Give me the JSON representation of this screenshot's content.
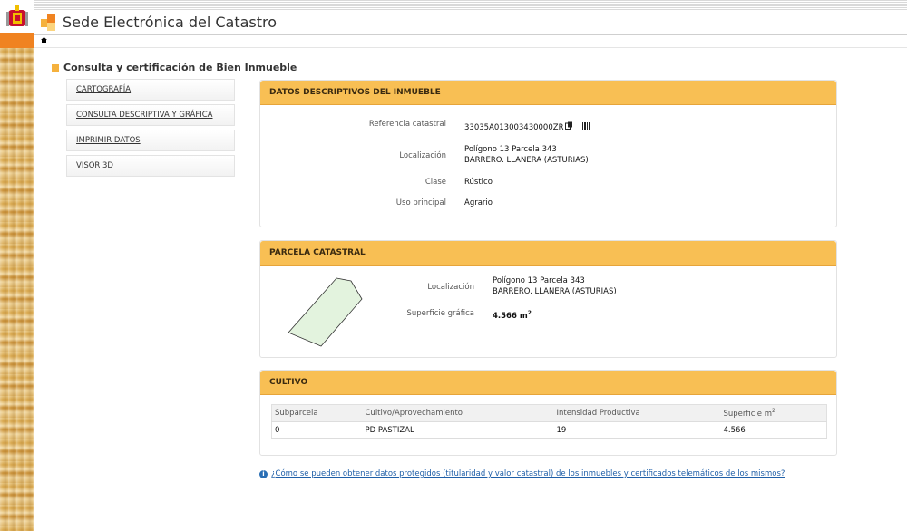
{
  "header": {
    "site_title": "Sede Electrónica del Catastro"
  },
  "page": {
    "title": "Consulta y certificación de Bien Inmueble"
  },
  "menu": {
    "items": [
      {
        "label": "CARTOGRAFÍA"
      },
      {
        "label": "CONSULTA DESCRIPTIVA Y GRÁFICA"
      },
      {
        "label": "IMPRIMIR DATOS"
      },
      {
        "label": "VISOR 3D"
      }
    ]
  },
  "datos": {
    "title": "DATOS DESCRIPTIVOS DEL INMUEBLE",
    "referencia_label": "Referencia catastral",
    "referencia_value": "33035A013003430000ZR",
    "localizacion_label": "Localización",
    "localizacion_line1": "Polígono 13 Parcela 343",
    "localizacion_line2": "BARRERO. LLANERA (ASTURIAS)",
    "clase_label": "Clase",
    "clase_value": "Rústico",
    "uso_label": "Uso principal",
    "uso_value": "Agrario"
  },
  "parcela": {
    "title": "PARCELA CATASTRAL",
    "localizacion_label": "Localización",
    "localizacion_line1": "Polígono 13 Parcela 343",
    "localizacion_line2": "BARRERO. LLANERA (ASTURIAS)",
    "superficie_label": "Superficie gráfica",
    "superficie_value": "4.566 m",
    "superficie_sup": "2"
  },
  "cultivo": {
    "title": "CULTIVO",
    "headers": {
      "subparcela": "Subparcela",
      "cultivo": "Cultivo/Aprovechamiento",
      "intensidad": "Intensidad Productiva",
      "superficie": "Superficie m",
      "superficie_sup": "2"
    },
    "rows": [
      {
        "subparcela": "0",
        "cultivo": "PD PASTIZAL",
        "intensidad": "19",
        "superficie": "4.566"
      }
    ]
  },
  "footer": {
    "info_link": "¿Cómo se pueden obtener datos protegidos (titularidad y valor catastral) de los inmuebles y certificados telemáticos de los mismos?"
  },
  "colors": {
    "panel_header": "#f8bf54",
    "accent_orange": "#f08321",
    "link_blue": "#1f5fa8"
  }
}
